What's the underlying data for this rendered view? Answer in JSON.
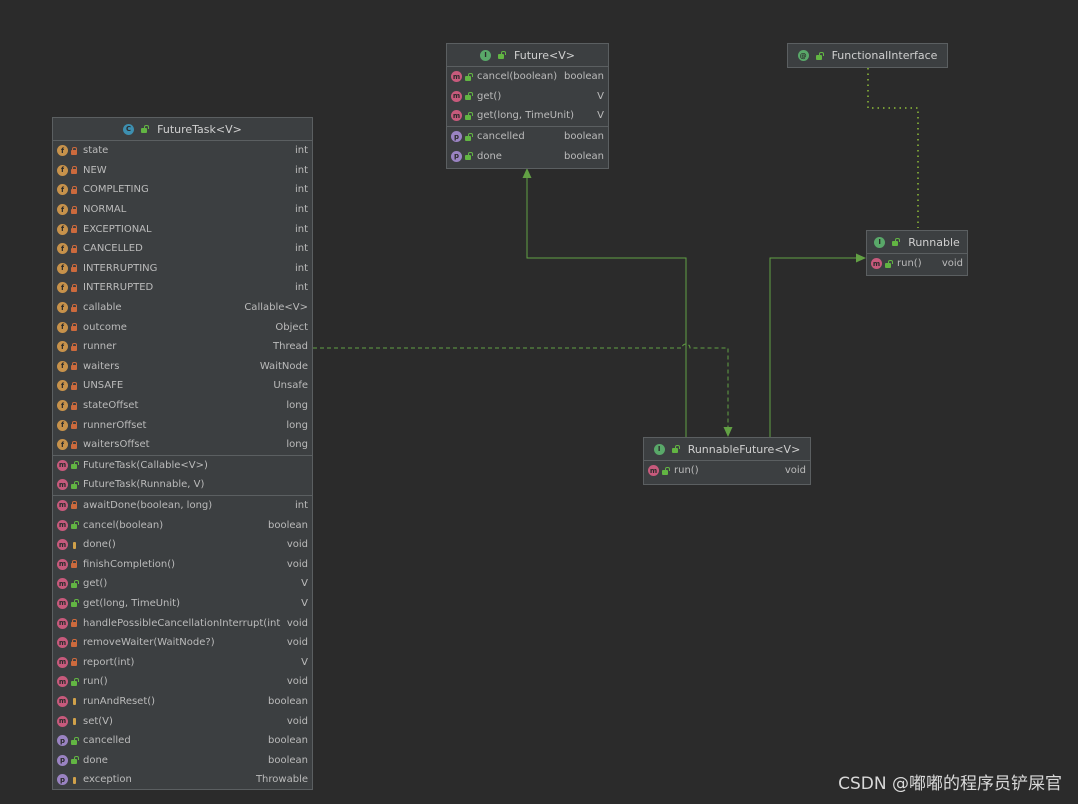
{
  "nodes": {
    "future": {
      "title": "Future<V>",
      "kind": "I",
      "sections": [
        [
          {
            "kind": "m",
            "vis": "public",
            "name": "cancel(boolean)",
            "type": "boolean"
          },
          {
            "kind": "m",
            "vis": "public",
            "name": "get()",
            "type": "V"
          },
          {
            "kind": "m",
            "vis": "public",
            "name": "get(long, TimeUnit)",
            "type": "V"
          }
        ],
        [
          {
            "kind": "p",
            "vis": "public",
            "name": "cancelled",
            "type": "boolean"
          },
          {
            "kind": "p",
            "vis": "public",
            "name": "done",
            "type": "boolean"
          }
        ]
      ]
    },
    "functional": {
      "title": "FunctionalInterface",
      "kind": "@",
      "sections": []
    },
    "runnable": {
      "title": "Runnable",
      "kind": "I",
      "sections": [
        [
          {
            "kind": "m",
            "vis": "public",
            "name": "run()",
            "type": "void"
          }
        ]
      ]
    },
    "runnableFuture": {
      "title": "RunnableFuture<V>",
      "kind": "I",
      "sections": [
        [
          {
            "kind": "m",
            "vis": "public",
            "name": "run()",
            "type": "void"
          }
        ]
      ]
    },
    "futureTask": {
      "title": "FutureTask<V>",
      "kind": "C",
      "sections": [
        [
          {
            "kind": "f",
            "vis": "private",
            "name": "state",
            "type": "int"
          },
          {
            "kind": "f",
            "vis": "private",
            "name": "NEW",
            "type": "int"
          },
          {
            "kind": "f",
            "vis": "private",
            "name": "COMPLETING",
            "type": "int"
          },
          {
            "kind": "f",
            "vis": "private",
            "name": "NORMAL",
            "type": "int"
          },
          {
            "kind": "f",
            "vis": "private",
            "name": "EXCEPTIONAL",
            "type": "int"
          },
          {
            "kind": "f",
            "vis": "private",
            "name": "CANCELLED",
            "type": "int"
          },
          {
            "kind": "f",
            "vis": "private",
            "name": "INTERRUPTING",
            "type": "int"
          },
          {
            "kind": "f",
            "vis": "private",
            "name": "INTERRUPTED",
            "type": "int"
          },
          {
            "kind": "f",
            "vis": "private",
            "name": "callable",
            "type": "Callable<V>"
          },
          {
            "kind": "f",
            "vis": "private",
            "name": "outcome",
            "type": "Object"
          },
          {
            "kind": "f",
            "vis": "private",
            "name": "runner",
            "type": "Thread"
          },
          {
            "kind": "f",
            "vis": "private",
            "name": "waiters",
            "type": "WaitNode"
          },
          {
            "kind": "f",
            "vis": "private",
            "name": "UNSAFE",
            "type": "Unsafe"
          },
          {
            "kind": "f",
            "vis": "private",
            "name": "stateOffset",
            "type": "long"
          },
          {
            "kind": "f",
            "vis": "private",
            "name": "runnerOffset",
            "type": "long"
          },
          {
            "kind": "f",
            "vis": "private",
            "name": "waitersOffset",
            "type": "long"
          }
        ],
        [
          {
            "kind": "m",
            "vis": "public",
            "name": "FutureTask(Callable<V>)",
            "type": ""
          },
          {
            "kind": "m",
            "vis": "public",
            "name": "FutureTask(Runnable, V)",
            "type": ""
          }
        ],
        [
          {
            "kind": "m",
            "vis": "private",
            "name": "awaitDone(boolean, long)",
            "type": "int"
          },
          {
            "kind": "m",
            "vis": "public",
            "name": "cancel(boolean)",
            "type": "boolean"
          },
          {
            "kind": "m",
            "vis": "protected",
            "name": "done()",
            "type": "void"
          },
          {
            "kind": "m",
            "vis": "private",
            "name": "finishCompletion()",
            "type": "void"
          },
          {
            "kind": "m",
            "vis": "public",
            "name": "get()",
            "type": "V"
          },
          {
            "kind": "m",
            "vis": "public",
            "name": "get(long, TimeUnit)",
            "type": "V"
          },
          {
            "kind": "m",
            "vis": "private",
            "name": "handlePossibleCancellationInterrupt(int)",
            "type": "void"
          },
          {
            "kind": "m",
            "vis": "private",
            "name": "removeWaiter(WaitNode?)",
            "type": "void"
          },
          {
            "kind": "m",
            "vis": "private",
            "name": "report(int)",
            "type": "V"
          },
          {
            "kind": "m",
            "vis": "public",
            "name": "run()",
            "type": "void"
          },
          {
            "kind": "m",
            "vis": "protected",
            "name": "runAndReset()",
            "type": "boolean"
          },
          {
            "kind": "m",
            "vis": "protected",
            "name": "set(V)",
            "type": "void"
          },
          {
            "kind": "p",
            "vis": "public",
            "name": "cancelled",
            "type": "boolean"
          },
          {
            "kind": "p",
            "vis": "public",
            "name": "done",
            "type": "boolean"
          },
          {
            "kind": "p",
            "vis": "protected",
            "name": "exception",
            "type": "Throwable"
          }
        ]
      ]
    }
  },
  "watermark": "CSDN @嘟嘟的程序员铲屎官",
  "colors": {
    "background": "#2b2b2b",
    "node": "#3c3f41",
    "border": "#5b5f61",
    "edge_green": "#62a044",
    "edge_dotted": "#8fbf3a"
  }
}
